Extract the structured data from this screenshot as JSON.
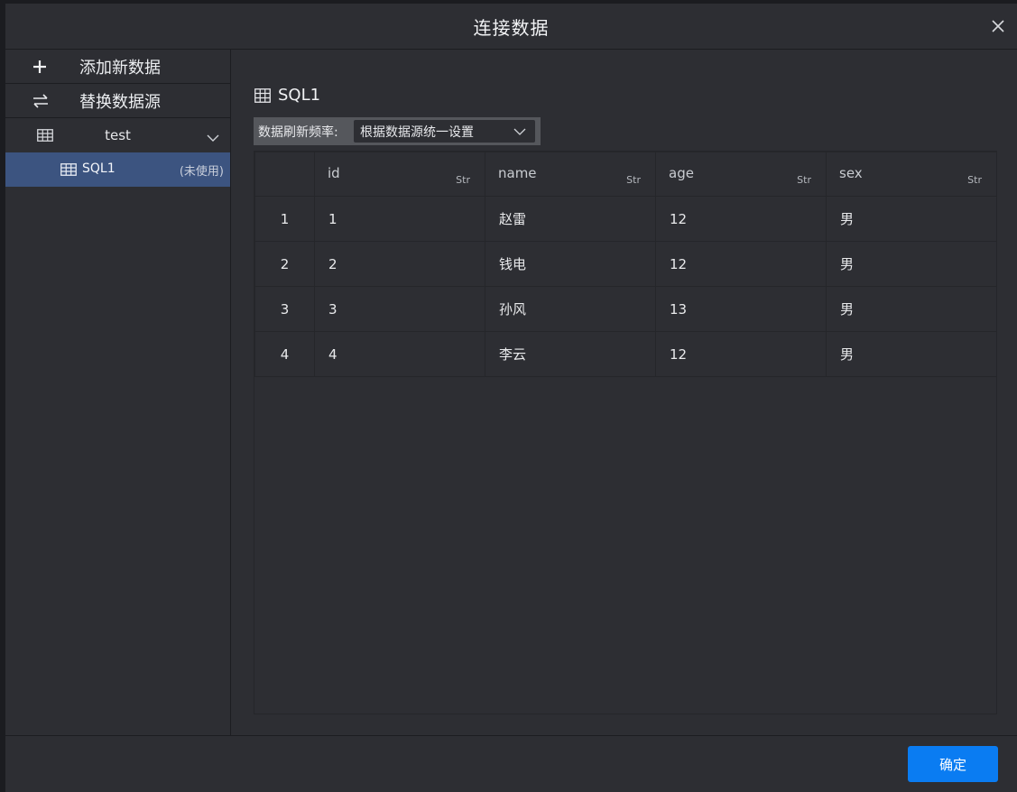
{
  "dialog": {
    "title": "连接数据"
  },
  "sidebar": {
    "actions": [
      {
        "label": "添加新数据",
        "icon": "plus-icon"
      },
      {
        "label": "替换数据源",
        "icon": "swap-icon"
      }
    ],
    "group": {
      "name": "test",
      "icon": "table-icon"
    },
    "items": [
      {
        "name": "SQL1",
        "status": "(未使用)",
        "icon": "table-icon"
      }
    ]
  },
  "main": {
    "title": "SQL1",
    "refresh_label": "数据刷新频率:",
    "refresh_value": "根据数据源统一设置",
    "table": {
      "columns": [
        {
          "name": "id",
          "type": "Str"
        },
        {
          "name": "name",
          "type": "Str"
        },
        {
          "name": "age",
          "type": "Str"
        },
        {
          "name": "sex",
          "type": "Str"
        }
      ],
      "rows": [
        {
          "index": "1",
          "cells": [
            "1",
            "赵雷",
            "12",
            "男"
          ]
        },
        {
          "index": "2",
          "cells": [
            "2",
            "钱电",
            "12",
            "男"
          ]
        },
        {
          "index": "3",
          "cells": [
            "3",
            "孙风",
            "13",
            "男"
          ]
        },
        {
          "index": "4",
          "cells": [
            "4",
            "李云",
            "12",
            "男"
          ]
        }
      ]
    }
  },
  "footer": {
    "ok_label": "确定"
  },
  "colors": {
    "accent": "#0a7cf2",
    "selected": "#3c5480",
    "panel": "#2d2e33"
  }
}
